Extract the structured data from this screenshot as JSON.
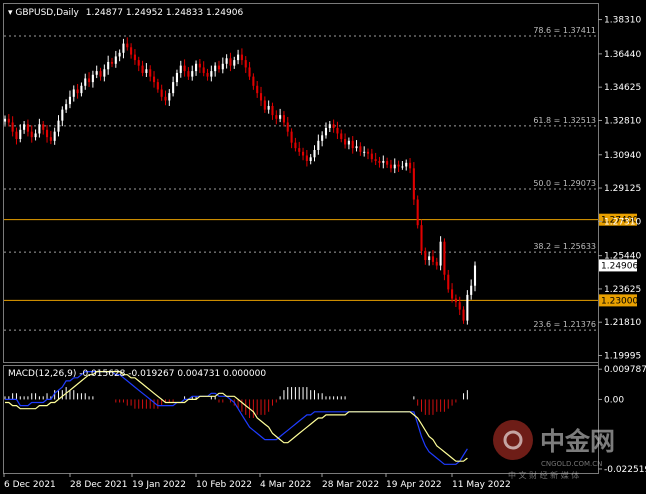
{
  "header": {
    "symbol_tf": "GBPUSD,Daily",
    "ohlc": "1.24877 1.24952 1.24833 1.24906"
  },
  "macd_header": "MACD(12,26,9) -0.015628 -0.019267 0.004731 0.000000",
  "watermark": {
    "brand": "中金网",
    "site": "CNGOLD.COM.CN",
    "tagline": "中 文 财 经 新 媒 体"
  },
  "colors": {
    "background": "#000000",
    "bull": "#ffffff",
    "bear": "#e00000",
    "fib": "#a0a0a0",
    "level": "#e8a000",
    "macd_signal": "#ffff99",
    "macd_line": "#1e3cff",
    "hist_pos": "#ffffff",
    "hist_neg": "#d01010"
  },
  "chart_data": [
    {
      "type": "candlestick",
      "ylim": [
        1.1975,
        1.3905
      ],
      "y_ticks": [
        "1.38310",
        "1.36440",
        "1.34625",
        "1.32810",
        "1.30940",
        "1.29125",
        "1.27310",
        "1.25440",
        "1.23625",
        "1.21810",
        "1.19995"
      ],
      "x_ticks": [
        "6 Dec 2021",
        "28 Dec 2021",
        "19 Jan 2022",
        "10 Feb 2022",
        "4 Mar 2022",
        "28 Mar 2022",
        "19 Apr 2022",
        "11 May 2022"
      ],
      "fib_levels": [
        {
          "label": "78.6 = 1.37411",
          "value": 1.37411
        },
        {
          "label": "61.8 = 1.32513",
          "value": 1.32513
        },
        {
          "label": "50.0 = 1.29073",
          "value": 1.29073
        },
        {
          "label": "38.2 = 1.25633",
          "value": 1.25633
        },
        {
          "label": "23.6 = 1.21376",
          "value": 1.21376
        }
      ],
      "horizontal_levels": [
        {
          "label": "1.27400",
          "value": 1.274
        },
        {
          "label": "1.23000",
          "value": 1.23
        }
      ],
      "current_price": "1.24906",
      "closes": [
        1.329,
        1.327,
        1.322,
        1.318,
        1.323,
        1.326,
        1.322,
        1.319,
        1.321,
        1.326,
        1.323,
        1.319,
        1.317,
        1.322,
        1.328,
        1.334,
        1.337,
        1.341,
        1.345,
        1.343,
        1.347,
        1.351,
        1.349,
        1.353,
        1.355,
        1.352,
        1.356,
        1.36,
        1.359,
        1.363,
        1.365,
        1.37,
        1.368,
        1.364,
        1.361,
        1.358,
        1.354,
        1.356,
        1.352,
        1.349,
        1.345,
        1.341,
        1.339,
        1.343,
        1.349,
        1.354,
        1.358,
        1.355,
        1.352,
        1.355,
        1.359,
        1.357,
        1.354,
        1.352,
        1.355,
        1.358,
        1.356,
        1.359,
        1.362,
        1.358,
        1.361,
        1.364,
        1.361,
        1.357,
        1.352,
        1.347,
        1.343,
        1.339,
        1.334,
        1.336,
        1.331,
        1.329,
        1.331,
        1.327,
        1.322,
        1.316,
        1.313,
        1.311,
        1.309,
        1.306,
        1.308,
        1.312,
        1.317,
        1.32,
        1.324,
        1.326,
        1.324,
        1.321,
        1.318,
        1.315,
        1.317,
        1.313,
        1.314,
        1.311,
        1.311,
        1.31,
        1.307,
        1.306,
        1.305,
        1.306,
        1.304,
        1.302,
        1.304,
        1.303,
        1.303,
        1.305,
        1.302,
        1.285,
        1.271,
        1.257,
        1.252,
        1.254,
        1.251,
        1.249,
        1.262,
        1.244,
        1.236,
        1.231,
        1.229,
        1.225,
        1.219,
        1.233,
        1.238,
        1.249
      ]
    },
    {
      "type": "macd",
      "params": "12,26,9",
      "ylim": [
        -0.0235,
        0.0105
      ],
      "y_ticks": [
        "0.009787",
        "0.00",
        "-0.022519"
      ],
      "macd": [
        0.0,
        0.0,
        0.0,
        0.0,
        -0.002,
        -0.002,
        -0.002,
        -0.001,
        -0.001,
        -0.001,
        -0.001,
        0.0,
        0.0,
        0.002,
        0.003,
        0.004,
        0.006,
        0.006,
        0.007,
        0.007,
        0.008,
        0.009,
        0.009,
        0.009,
        0.009,
        0.009,
        0.009,
        0.009,
        0.009,
        0.008,
        0.008,
        0.007,
        0.006,
        0.005,
        0.004,
        0.003,
        0.002,
        0.001,
        0.0,
        -0.001,
        -0.002,
        -0.002,
        -0.002,
        -0.002,
        -0.002,
        -0.001,
        -0.001,
        0.0,
        0.0,
        0.001,
        0.001,
        0.001,
        0.001,
        0.001,
        0.002,
        0.002,
        0.001,
        0.001,
        0.001,
        0.0,
        -0.001,
        -0.003,
        -0.005,
        -0.007,
        -0.009,
        -0.01,
        -0.011,
        -0.012,
        -0.013,
        -0.013,
        -0.013,
        -0.013,
        -0.012,
        -0.011,
        -0.01,
        -0.009,
        -0.008,
        -0.007,
        -0.006,
        -0.005,
        -0.005,
        -0.004,
        -0.004,
        -0.004,
        -0.004,
        -0.004,
        -0.004,
        -0.004,
        -0.004,
        -0.004,
        -0.004,
        -0.004,
        -0.004,
        -0.004,
        -0.004,
        -0.004,
        -0.004,
        -0.004,
        -0.004,
        -0.004,
        -0.004,
        -0.004,
        -0.004,
        -0.004,
        -0.004,
        -0.004,
        -0.004,
        -0.004,
        -0.008,
        -0.012,
        -0.015,
        -0.017,
        -0.018,
        -0.019,
        -0.02,
        -0.021,
        -0.021,
        -0.021,
        -0.021,
        -0.02,
        -0.018,
        -0.016
      ],
      "signal": [
        -0.001,
        -0.001,
        -0.002,
        -0.002,
        -0.003,
        -0.003,
        -0.003,
        -0.003,
        -0.003,
        -0.002,
        -0.002,
        -0.002,
        -0.001,
        -0.001,
        0.0,
        0.001,
        0.002,
        0.003,
        0.004,
        0.005,
        0.006,
        0.007,
        0.008,
        0.008,
        0.009,
        0.009,
        0.009,
        0.009,
        0.009,
        0.009,
        0.009,
        0.008,
        0.008,
        0.007,
        0.007,
        0.006,
        0.005,
        0.004,
        0.003,
        0.002,
        0.001,
        0.0,
        -0.001,
        -0.001,
        -0.001,
        -0.001,
        -0.001,
        -0.001,
        0.0,
        0.0,
        0.0,
        0.001,
        0.001,
        0.001,
        0.001,
        0.001,
        0.002,
        0.002,
        0.001,
        0.001,
        0.001,
        0.0,
        -0.001,
        -0.002,
        -0.003,
        -0.004,
        -0.006,
        -0.007,
        -0.008,
        -0.009,
        -0.011,
        -0.012,
        -0.013,
        -0.014,
        -0.014,
        -0.013,
        -0.012,
        -0.011,
        -0.01,
        -0.009,
        -0.008,
        -0.007,
        -0.006,
        -0.006,
        -0.005,
        -0.005,
        -0.005,
        -0.005,
        -0.005,
        -0.005,
        -0.004,
        -0.004,
        -0.004,
        -0.004,
        -0.004,
        -0.004,
        -0.004,
        -0.004,
        -0.004,
        -0.004,
        -0.004,
        -0.004,
        -0.004,
        -0.004,
        -0.004,
        -0.004,
        -0.004,
        -0.005,
        -0.006,
        -0.008,
        -0.01,
        -0.012,
        -0.013,
        -0.015,
        -0.016,
        -0.017,
        -0.018,
        -0.019,
        -0.02,
        -0.02,
        -0.02,
        -0.019
      ],
      "histogram": [
        0.001,
        0.001,
        0.002,
        0.002,
        0.001,
        0.001,
        0.001,
        0.002,
        0.002,
        0.001,
        0.001,
        0.002,
        0.001,
        0.003,
        0.003,
        0.003,
        0.004,
        0.003,
        0.003,
        0.002,
        0.002,
        0.002,
        0.001,
        0.001,
        0.0,
        0.0,
        0.0,
        0.0,
        0.0,
        -0.001,
        -0.001,
        -0.001,
        -0.002,
        -0.002,
        -0.003,
        -0.003,
        -0.003,
        -0.003,
        -0.003,
        -0.003,
        -0.003,
        -0.002,
        -0.001,
        -0.001,
        -0.001,
        0.0,
        0.0,
        0.001,
        0.0,
        0.001,
        0.001,
        0.0,
        0.0,
        0.0,
        0.001,
        0.001,
        -0.001,
        -0.001,
        0.0,
        -0.001,
        -0.002,
        -0.003,
        -0.004,
        -0.005,
        -0.006,
        -0.006,
        -0.005,
        -0.005,
        -0.005,
        -0.004,
        -0.002,
        -0.001,
        0.001,
        0.003,
        0.004,
        0.004,
        0.004,
        0.004,
        0.004,
        0.004,
        0.003,
        0.003,
        0.002,
        0.002,
        0.001,
        0.001,
        0.001,
        0.001,
        0.001,
        0.001,
        0.0,
        0.0,
        0.0,
        0.0,
        0.0,
        0.0,
        0.0,
        0.0,
        0.0,
        0.0,
        0.0,
        0.0,
        0.0,
        0.0,
        0.0,
        0.0,
        0.0,
        0.001,
        -0.002,
        -0.004,
        -0.005,
        -0.005,
        -0.005,
        -0.004,
        -0.004,
        -0.004,
        -0.003,
        -0.002,
        -0.001,
        0.0,
        0.002,
        0.003
      ]
    }
  ]
}
